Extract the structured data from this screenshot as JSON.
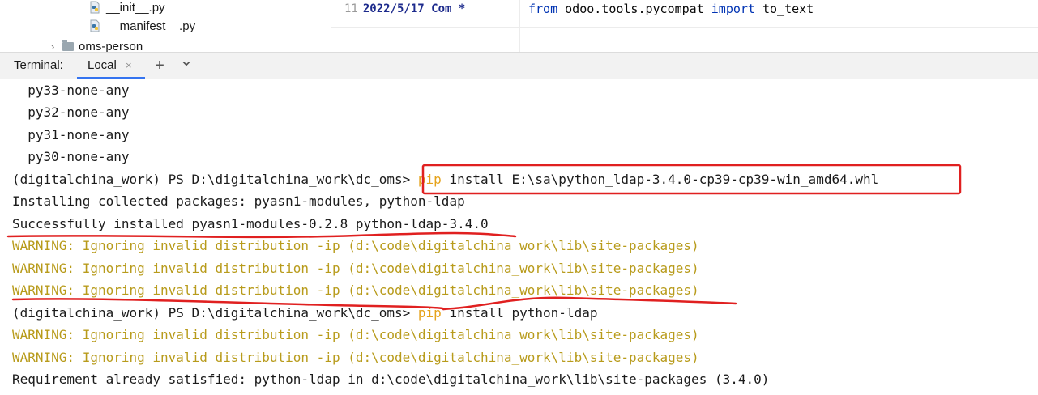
{
  "project_tree": {
    "items": [
      {
        "label": "__init__.py"
      },
      {
        "label": "__manifest__.py"
      },
      {
        "label": "oms-person"
      }
    ]
  },
  "gutter": {
    "line_number": "11",
    "annotation": "2022/5/17 Com *"
  },
  "editor": {
    "kw_from": "from",
    "module": " odoo.tools.pycompat ",
    "kw_import": "import",
    "name": " to_text"
  },
  "terminal_tabs": {
    "title": "Terminal:",
    "active_tab": "Local",
    "close_glyph": "×",
    "add_glyph": "+",
    "dropdown_glyph": "⌄"
  },
  "terminal": {
    "lines": [
      {
        "text": "  py33-none-any"
      },
      {
        "text": "  py32-none-any"
      },
      {
        "text": "  py31-none-any"
      },
      {
        "text": "  py30-none-any"
      },
      {
        "prompt": "(digitalchina_work) PS D:\\digitalchina_work\\dc_oms> ",
        "cmd_kw": "pip",
        "cmd_rest": " install E:\\sa\\python_ldap-3.4.0-cp39-cp39-win_amd64.whl"
      },
      {
        "text": "Installing collected packages: pyasn1-modules, python-ldap"
      },
      {
        "text": "Successfully installed pyasn1-modules-0.2.8 python-ldap-3.4.0"
      },
      {
        "warn": "WARNING: Ignoring invalid distribution -ip (d:\\code\\digitalchina_work\\lib\\site-packages)"
      },
      {
        "warn": "WARNING: Ignoring invalid distribution -ip (d:\\code\\digitalchina_work\\lib\\site-packages)"
      },
      {
        "warn": "WARNING: Ignoring invalid distribution -ip (d:\\code\\digitalchina_work\\lib\\site-packages)"
      },
      {
        "prompt": "(digitalchina_work) PS D:\\digitalchina_work\\dc_oms> ",
        "cmd_kw": "pip",
        "cmd_rest": " install python-ldap"
      },
      {
        "warn": "WARNING: Ignoring invalid distribution -ip (d:\\code\\digitalchina_work\\lib\\site-packages)"
      },
      {
        "warn": "WARNING: Ignoring invalid distribution -ip (d:\\code\\digitalchina_work\\lib\\site-packages)"
      },
      {
        "text": "Requirement already satisfied: python-ldap in d:\\code\\digitalchina_work\\lib\\site-packages (3.4.0)"
      }
    ]
  },
  "colors": {
    "warning": "#b89b1b",
    "pip_keyword": "#e5a21a",
    "annotation_red": "#e02020",
    "tab_underline": "#3574f0"
  }
}
